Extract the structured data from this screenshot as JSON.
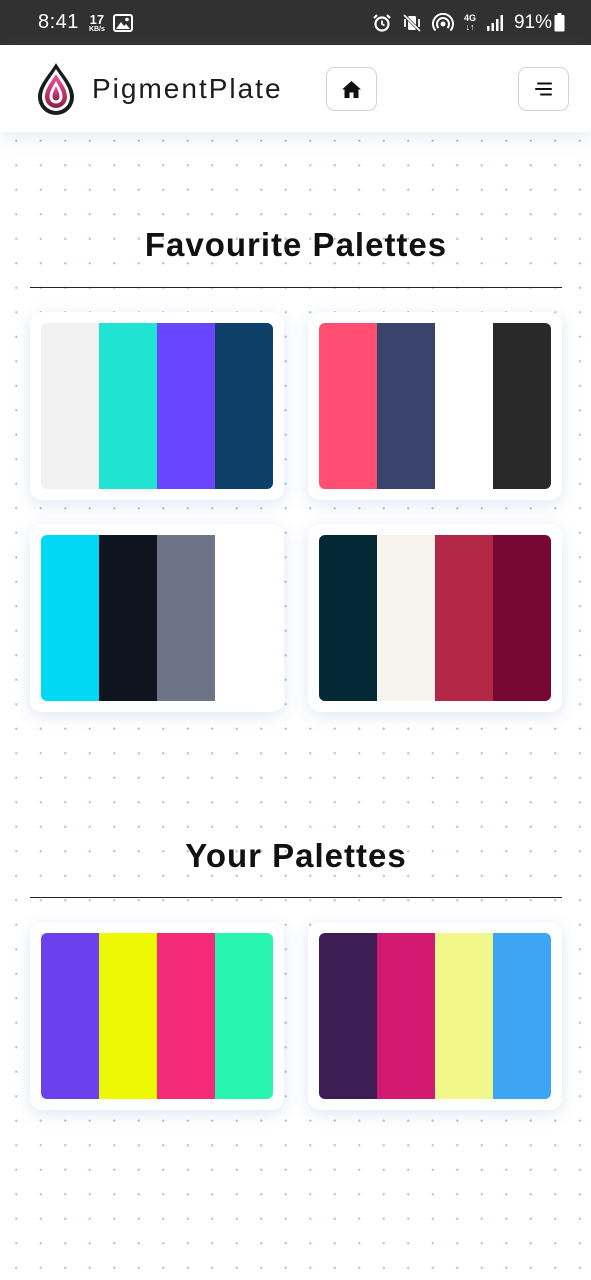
{
  "status_bar": {
    "time": "8:41",
    "net_speed_value": "17",
    "net_speed_unit": "KB/s",
    "network_type_top": "4G",
    "network_type_bottom": "↓↑",
    "battery_percent": "91%"
  },
  "header": {
    "brand": "PigmentPlate",
    "logo_icon": "droplet-logo-icon",
    "home_icon": "home-icon",
    "menu_icon": "menu-icon"
  },
  "sections": {
    "favourites": {
      "title": "Favourite Palettes",
      "palettes": [
        {
          "colors": [
            "#F2F2F3",
            "#20E3D1",
            "#6A45FF",
            "#0E3F69"
          ]
        },
        {
          "colors": [
            "#FF4E72",
            "#3A436C",
            "#FFFFFF",
            "#292929"
          ]
        },
        {
          "colors": [
            "#00D8F6",
            "#0E151F",
            "#6D7487",
            "#FFFFFF"
          ]
        },
        {
          "colors": [
            "#042836",
            "#F6F3EC",
            "#B22745",
            "#760833"
          ]
        }
      ]
    },
    "yours": {
      "title": "Your Palettes",
      "palettes": [
        {
          "colors": [
            "#6B41EE",
            "#EEF804",
            "#F42A79",
            "#28F5B0"
          ]
        },
        {
          "colors": [
            "#3E1D55",
            "#D21A73",
            "#F1F889",
            "#3EA4F4"
          ]
        }
      ]
    }
  },
  "colors": {
    "status_bar_bg": "#313131",
    "logo_gradient_start": "#E23A86",
    "logo_gradient_end": "#7A1A40"
  }
}
